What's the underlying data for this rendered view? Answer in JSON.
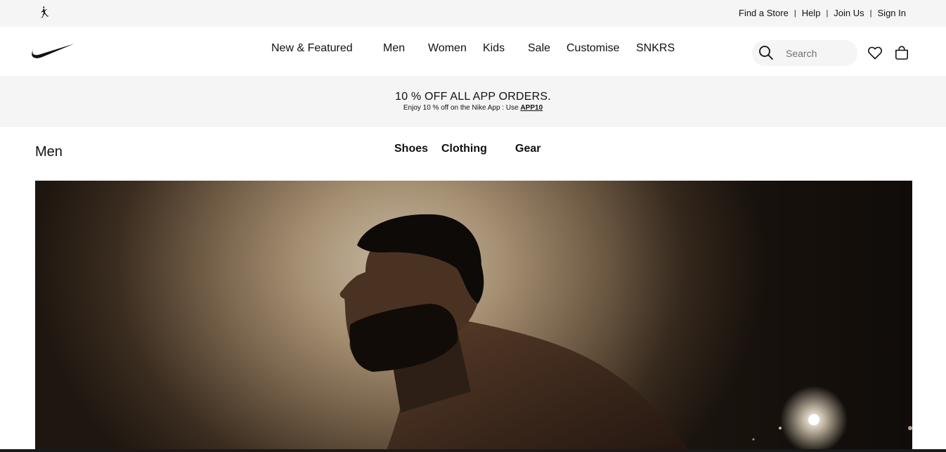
{
  "utility": {
    "links": [
      "Find a Store",
      "Help",
      "Join Us",
      "Sign In"
    ],
    "separator": "|"
  },
  "nav": {
    "items": [
      "New & Featured",
      "Men",
      "Women",
      "Kids",
      "Sale",
      "Customise",
      "SNKRS"
    ]
  },
  "search": {
    "placeholder": "Search"
  },
  "icons": {
    "jordan": "jordan-logo-icon",
    "brand": "nike-swoosh-icon",
    "search": "search-icon",
    "favourites": "heart-icon",
    "bag": "bag-icon"
  },
  "promo": {
    "title": "10 % OFF ALL APP ORDERS.",
    "subtitle": "Enjoy 10 % off on the Nike App : Use ",
    "code": "APP10"
  },
  "category": {
    "title": "Men",
    "subnav": [
      "Shoes",
      "Clothing",
      "Gear"
    ]
  },
  "colors": {
    "utility_bg": "#f5f5f5",
    "text": "#111111",
    "search_bg": "#f5f5f5"
  }
}
